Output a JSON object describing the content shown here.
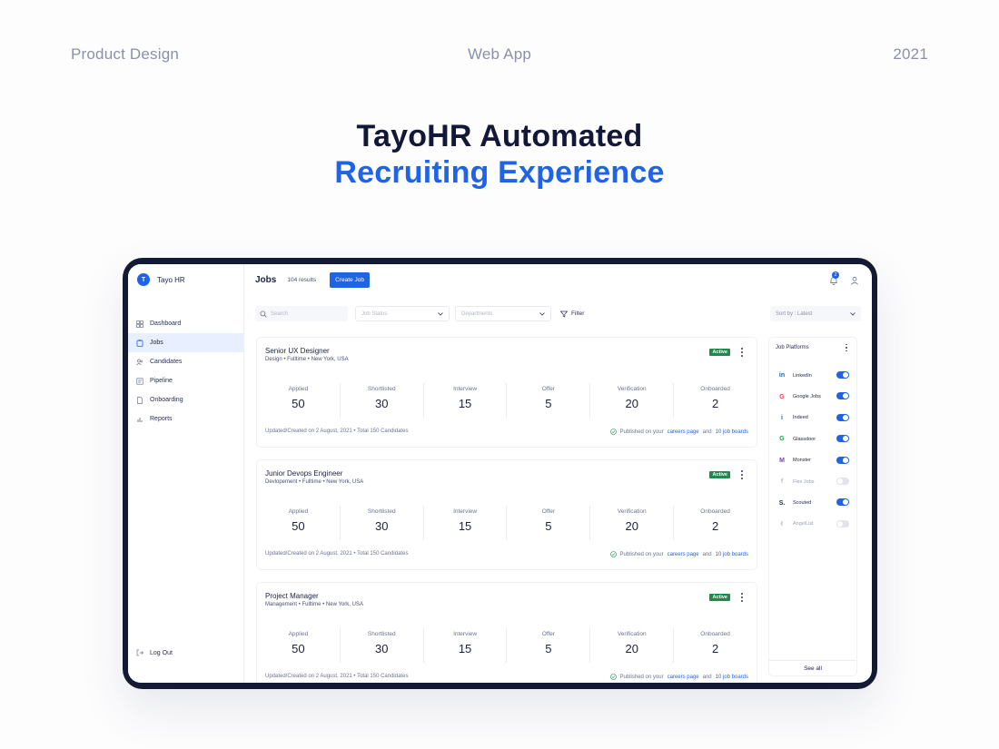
{
  "meta": {
    "left": "Product Design",
    "center": "Web App",
    "right": "2021"
  },
  "hero": {
    "line1": "TayoHR Automated",
    "line2": "Recruiting Experience"
  },
  "app": {
    "brand": {
      "initial": "T",
      "name": "Tayo HR"
    },
    "nav": [
      {
        "label": "Dashboard",
        "icon": "grid-icon",
        "active": false
      },
      {
        "label": "Jobs",
        "icon": "clipboard-icon",
        "active": true
      },
      {
        "label": "Candidates",
        "icon": "users-icon",
        "active": false
      },
      {
        "label": "Pipeline",
        "icon": "pipeline-icon",
        "active": false
      },
      {
        "label": "Onboarding",
        "icon": "document-icon",
        "active": false
      },
      {
        "label": "Reports",
        "icon": "bar-chart-icon",
        "active": false
      }
    ],
    "logout": "Log Out",
    "header": {
      "title": "Jobs",
      "count": "104 results",
      "create": "Create Job",
      "notifications": "2"
    },
    "filters": {
      "search_placeholder": "Search",
      "status": "Job Status",
      "departments": "Departments",
      "filter": "Filter",
      "sort": "Sort by : Latest"
    },
    "jobs": [
      {
        "title": "Senior UX Designer",
        "dept": "Design",
        "type": "Fulltime",
        "location": "New York, USA",
        "status": "Active",
        "stats": [
          {
            "label": "Applied",
            "value": "50"
          },
          {
            "label": "Shortlisted",
            "value": "30"
          },
          {
            "label": "Interview",
            "value": "15"
          },
          {
            "label": "Offer",
            "value": "5"
          },
          {
            "label": "Verification",
            "value": "20"
          },
          {
            "label": "Onboarded",
            "value": "2"
          }
        ],
        "updated": "Updated/Created on  2 August, 2021  •  Total 150 Candidates",
        "published": "Published on your",
        "careers": "careers page",
        "and": "and",
        "boards": "10 job boards"
      },
      {
        "title": "Junior Devops Engineer",
        "dept": "Devlopement",
        "type": "Fulltime",
        "location": "New York, USA",
        "status": "Active",
        "stats": [
          {
            "label": "Applied",
            "value": "50"
          },
          {
            "label": "Shortlisted",
            "value": "30"
          },
          {
            "label": "Interview",
            "value": "15"
          },
          {
            "label": "Offer",
            "value": "5"
          },
          {
            "label": "Verification",
            "value": "20"
          },
          {
            "label": "Onboarded",
            "value": "2"
          }
        ],
        "updated": "Updated/Created on  2 August, 2021  •  Total 150 Candidates",
        "published": "Published on your",
        "careers": "careers page",
        "and": "and",
        "boards": "10 job boards"
      },
      {
        "title": "Project Manager",
        "dept": "Management",
        "type": "Fulltime",
        "location": "New York, USA",
        "status": "Active",
        "stats": [
          {
            "label": "Applied",
            "value": "50"
          },
          {
            "label": "Shortlisted",
            "value": "30"
          },
          {
            "label": "Interview",
            "value": "15"
          },
          {
            "label": "Offer",
            "value": "5"
          },
          {
            "label": "Verification",
            "value": "20"
          },
          {
            "label": "Onboarded",
            "value": "2"
          }
        ],
        "updated": "Updated/Created on  2 August, 2021  •  Total 150 Candidates",
        "published": "Published on your",
        "careers": "careers page",
        "and": "and",
        "boards": "10 job boards"
      }
    ],
    "platforms": {
      "title": "Job Platforms",
      "see_all": "See all",
      "items": [
        {
          "name": "LinkedIn",
          "enabled": true,
          "icon": "linkedin-icon",
          "glyph": "in",
          "color": "#0a66c2"
        },
        {
          "name": "Google Jobs",
          "enabled": true,
          "icon": "google-icon",
          "glyph": "G",
          "color": "#ea4335"
        },
        {
          "name": "Indeed",
          "enabled": true,
          "icon": "indeed-icon",
          "glyph": "i",
          "color": "#2164f3"
        },
        {
          "name": "Glassdoor",
          "enabled": true,
          "icon": "glassdoor-icon",
          "glyph": "G",
          "color": "#0caa41"
        },
        {
          "name": "Monster",
          "enabled": true,
          "icon": "monster-icon",
          "glyph": "M",
          "color": "#6e45a5"
        },
        {
          "name": "Flex Jobs",
          "enabled": false,
          "icon": "flexjobs-icon",
          "glyph": "f",
          "color": "#b8bccb"
        },
        {
          "name": "Scouted",
          "enabled": true,
          "icon": "scouted-icon",
          "glyph": "S.",
          "color": "#1a2a6c"
        },
        {
          "name": "AngelList",
          "enabled": false,
          "icon": "angellist-icon",
          "glyph": "✌",
          "color": "#9aa0b4"
        }
      ]
    }
  },
  "colors": {
    "accent": "#1f64e6",
    "success": "#1f8a4c",
    "frame": "#141a33",
    "heading": "#141838"
  }
}
